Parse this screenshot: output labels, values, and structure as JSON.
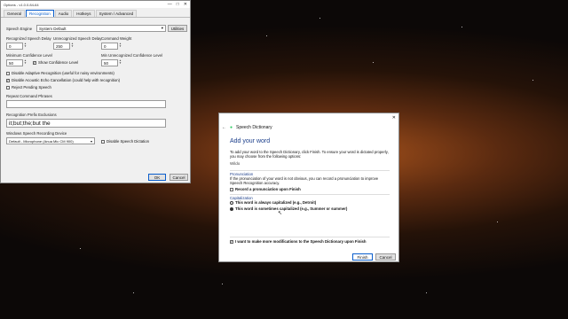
{
  "options_window": {
    "title": "Options - v1.0.0.84-64",
    "tabs": [
      "General",
      "Recognition",
      "Audio",
      "Hotkeys",
      "System / Advanced"
    ],
    "active_tab": "Recognition",
    "speech_engine_label": "Speech Engine",
    "speech_engine_value": "System Default",
    "utilities_label": "Utilities",
    "recognized_delay_label": "Recognized Speech Delay",
    "recognized_delay_value": "0",
    "unrecognized_delay_label": "Unrecognized Speech Delay",
    "unrecognized_delay_value": "250",
    "command_weight_label": "Command Weight",
    "command_weight_value": "0",
    "min_confidence_label": "Minimum Confidence Level",
    "min_confidence_value": "50",
    "show_confidence_label": "Show Confidence Level",
    "show_confidence_checked": true,
    "min_unrec_conf_label": "Min Unrecognized Confidence Level",
    "min_unrec_conf_value": "50",
    "disable_adaptive_label": "Disable Adaptive Recognition (useful for noisy environments)",
    "disable_adaptive_checked": false,
    "disable_echo_label": "Disable Acoustic Echo Cancellation (could help with recognition)",
    "disable_echo_checked": true,
    "reject_pending_label": "Reject Pending Speech",
    "reject_pending_checked": false,
    "repeat_phrases_label": "Repeat Command Phrases",
    "repeat_phrases_value": "",
    "prefix_exclusions_label": "Recognition Prefix Exclusions",
    "prefix_exclusions_value": "it;but;the;but the",
    "recording_device_label": "Windows Speech Recording Device",
    "recording_device_value": "Default - Microphone (Anua Mic CM 900)",
    "disable_dictation_label": "Disable Speech Dictation",
    "disable_dictation_checked": false,
    "ok_label": "OK",
    "cancel_label": "Cancel"
  },
  "dictionary_dialog": {
    "title": "Speech Dictionary",
    "heading": "Add your word",
    "intro": "To add your word to the Speech Dictionary, click Finish. To ensure your word is dictated properly, you may choose from the following options:",
    "word": "Wildo",
    "pronunciation_heading": "Pronunciation",
    "pronunciation_text": "If the pronunciation of your word is not obvious, you can record a pronunciation to improve Speech Recognition accuracy.",
    "record_label": "Record a pronunciation upon Finish",
    "record_checked": false,
    "capitalization_heading": "Capitalization",
    "cap_always_label": "This word is always capitalized (e.g., Detroit)",
    "cap_sometimes_label": "This word is sometimes capitalized (e.g., Summer or summer)",
    "cap_selected": "sometimes",
    "more_mods_label": "I want to make more modifications to the Speech Dictionary upon Finish",
    "more_mods_checked": true,
    "finish_label": "Finish",
    "cancel_label": "Cancel"
  }
}
